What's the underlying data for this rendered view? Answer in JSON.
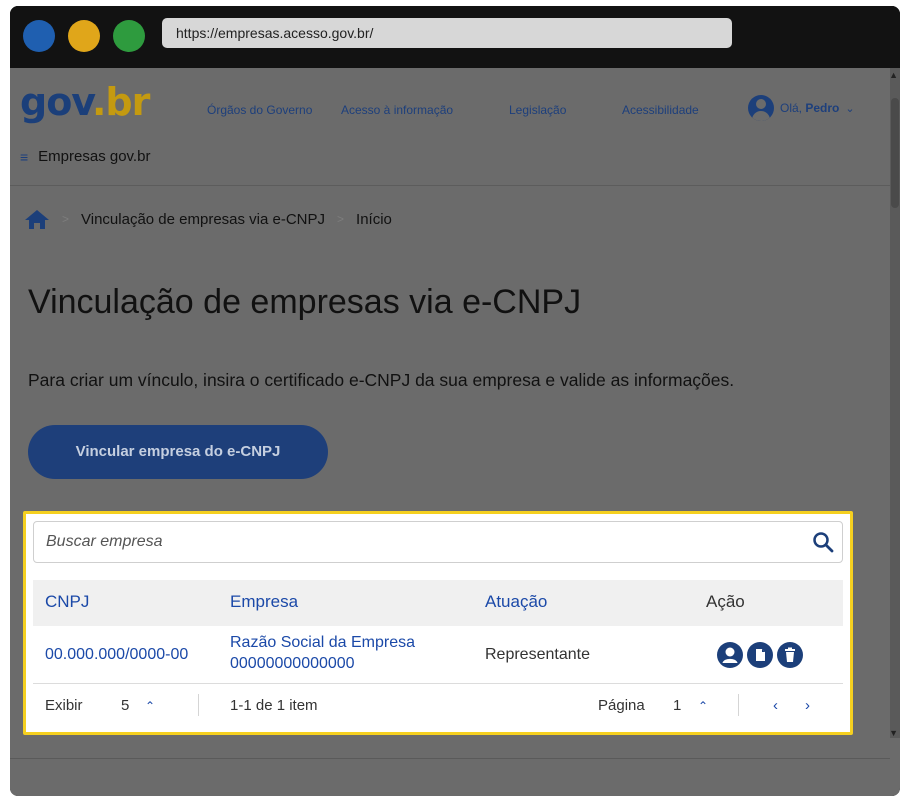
{
  "browser": {
    "url": "https://empresas.acesso.gov.br/",
    "traffic_colors": [
      "#1f5fb0",
      "#e0a61a",
      "#2e9b3e"
    ]
  },
  "header": {
    "logo_part1": "gov",
    "logo_part2": ".br",
    "nav": [
      "Órgãos do Governo",
      "Acesso à informação",
      "Legislação",
      "Acessibilidade"
    ],
    "greeting": "Olá,",
    "user_name": "Pedro",
    "site_name": "Empresas gov.br"
  },
  "breadcrumb": {
    "items": [
      "Vinculação de empresas via e-CNPJ",
      "Início"
    ]
  },
  "main": {
    "title": "Vinculação de empresas via e-CNPJ",
    "intro": "Para criar um vínculo, insira o certificado e-CNPJ da sua empresa e valide as informações.",
    "primary_button": "Vincular empresa do e-CNPJ"
  },
  "table": {
    "search_placeholder": "Buscar empresa",
    "columns": [
      "CNPJ",
      "Empresa",
      "Atuação",
      "Ação"
    ],
    "rows": [
      {
        "cnpj": "00.000.000/0000-00",
        "empresa_line1": "Razão Social da Empresa",
        "empresa_line2": "00000000000000",
        "atuacao": "Representante"
      }
    ],
    "footer": {
      "show_label": "Exibir",
      "show_value": "5",
      "range": "1-1 de 1 item",
      "page_label": "Página",
      "page_value": "1"
    }
  },
  "colors": {
    "primary": "#1e3f7a",
    "link": "#1b49a8",
    "highlight": "#f5d020"
  },
  "icons": [
    "home-icon",
    "user-icon",
    "search-icon",
    "person-icon",
    "copy-icon",
    "trash-icon",
    "chevron-up-icon",
    "chevron-left-icon",
    "chevron-right-icon",
    "hamburger-icon"
  ]
}
